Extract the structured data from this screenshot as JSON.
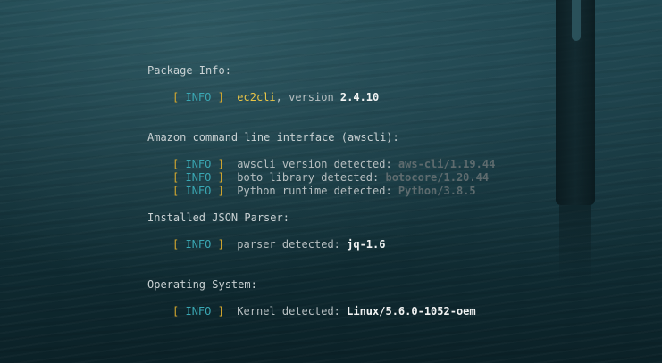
{
  "sections": [
    {
      "title": "Package Info:",
      "lines": [
        {
          "bracket_open": "[",
          "tag": "INFO",
          "bracket_close": "]",
          "name": "ec2cli",
          "text": ", version ",
          "value": "2.4.10"
        }
      ]
    },
    {
      "title": "Amazon command line interface (awscli):",
      "lines": [
        {
          "bracket_open": "[",
          "tag": "INFO",
          "bracket_close": "]",
          "text": "awscli version detected: ",
          "value": "aws-cli/1.19.44"
        },
        {
          "bracket_open": "[",
          "tag": "INFO",
          "bracket_close": "]",
          "text": "boto library detected: ",
          "value": "botocore/1.20.44"
        },
        {
          "bracket_open": "[",
          "tag": "INFO",
          "bracket_close": "]",
          "text": "Python runtime detected: ",
          "value": "Python/3.8.5"
        }
      ]
    },
    {
      "title": "Installed JSON Parser:",
      "lines": [
        {
          "bracket_open": "[",
          "tag": "INFO",
          "bracket_close": "]",
          "text": "parser detected: ",
          "value": "jq-1.6"
        }
      ]
    },
    {
      "title": "Operating System:",
      "lines": [
        {
          "bracket_open": "[",
          "tag": "INFO",
          "bracket_close": "]",
          "text": "Kernel detected: ",
          "value": "Linux/5.6.0-1052-oem"
        }
      ]
    }
  ],
  "colors": {
    "bracket": "#d7a92e",
    "tag": "#3aa8b4",
    "package_name": "#e8c547",
    "dim_value": "#5e6b6e",
    "bright_value": "#f1f3f3"
  }
}
